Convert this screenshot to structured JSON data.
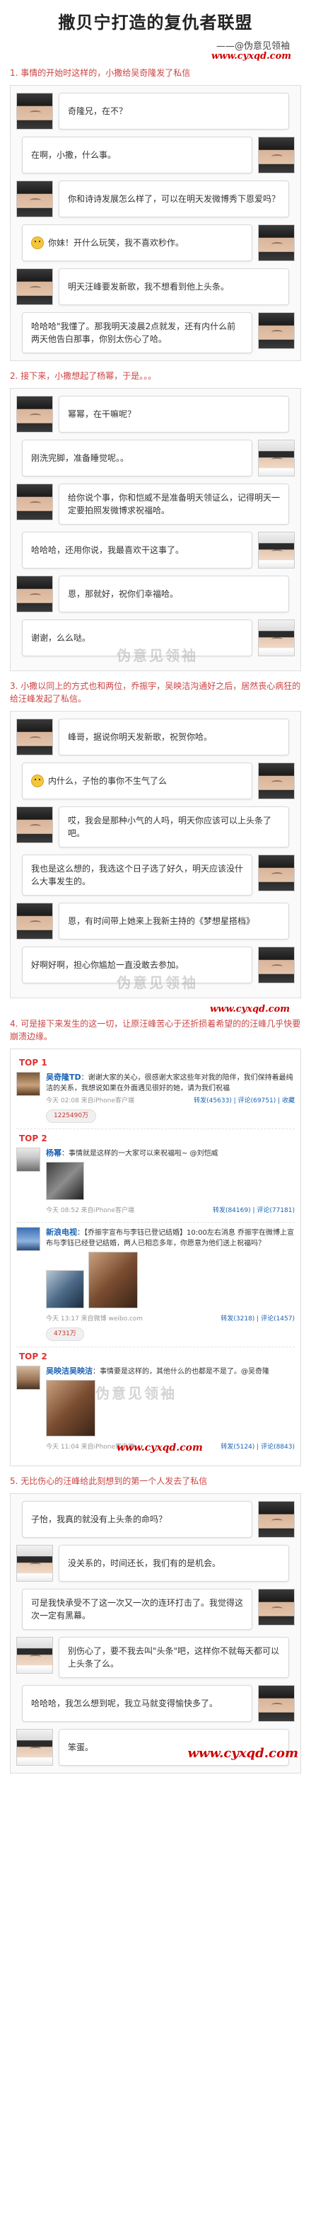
{
  "header": {
    "title": "撒贝宁打造的复仇者联盟",
    "subtitle": "——@伪意见领袖",
    "site": "www.cyxqd.com"
  },
  "sections": [
    {
      "title": "1. 事情的开始时这样的，小撒给吴奇隆发了私信",
      "messages": [
        {
          "side": "left",
          "avatar": "sa",
          "text": "奇隆兄，在不？"
        },
        {
          "side": "right",
          "avatar": "wu",
          "text": "在啊，小撒，什么事。"
        },
        {
          "side": "left",
          "avatar": "sa",
          "text": "你和诗诗发展怎么样了，可以在明天发微博秀下恩爱吗？"
        },
        {
          "side": "right",
          "avatar": "wu",
          "emoji": true,
          "text": "你妹！开什么玩笑，我不喜欢秒作。"
        },
        {
          "side": "left",
          "avatar": "sa",
          "text": "明天汪峰要发新歌，我不想看到他上头条。"
        },
        {
          "side": "right",
          "avatar": "wu",
          "text": "哈哈哈\"我懂了。那我明天凌晨2点就发，还有内什么前两天他告白那事，你别太伤心了哈。"
        }
      ]
    },
    {
      "title": "2. 接下来，小撒想起了杨幂，于是。。。",
      "messages": [
        {
          "side": "left",
          "avatar": "sa",
          "text": "幂幂，在干嘛呢？"
        },
        {
          "side": "right",
          "avatar": "mi",
          "text": "刚洗完脚，准备睡觉呢。。"
        },
        {
          "side": "left",
          "avatar": "sa",
          "text": "给你说个事，你和恺威不是准备明天领证么，记得明天一定要拍照发微博求祝福哈。"
        },
        {
          "side": "right",
          "avatar": "mi",
          "text": "哈哈哈，还用你说，我最喜欢干这事了。"
        },
        {
          "side": "left",
          "avatar": "sa",
          "text": "恩，那就好，祝你们幸福哈。"
        },
        {
          "side": "right",
          "avatar": "mi",
          "text": "谢谢，么么哒。"
        }
      ],
      "watermark": "伪意见领袖"
    },
    {
      "title": "3. 小撒以同上的方式也和两位，乔振宇，吴映洁沟通好之后，居然丧心病狂的给汪峰发起了私信。",
      "messages": [
        {
          "side": "left",
          "avatar": "sa",
          "text": "峰哥，据说你明天发新歌，祝贺你哈。"
        },
        {
          "side": "right",
          "avatar": "wang",
          "emoji": true,
          "text": "内什么，子怡的事你不生气了么"
        },
        {
          "side": "left",
          "avatar": "sa",
          "text": "哎，我会是那种小气的人吗，明天你应该可以上头条了吧。"
        },
        {
          "side": "right",
          "avatar": "wang",
          "text": "我也是这么想的，我选这个日子选了好久，明天应该没什么大事发生的。"
        },
        {
          "side": "left",
          "avatar": "sa",
          "text": "恩，有时间带上她来上我新主持的《梦想星搭档》"
        },
        {
          "side": "right",
          "avatar": "wang",
          "text": "好啊好啊，担心你尴尬一直没敢去参加。"
        }
      ],
      "watermark": "伪意见领袖",
      "site": "www.cyxqd.com"
    }
  ],
  "section4": {
    "title": "4. 可是接下来发生的这一切，让原汪峰苦心于还折损着希望的的汪峰几乎快要崩溃边缘。",
    "tops": [
      {
        "label": "TOP 1",
        "name": "吴奇隆TD",
        "text": "谢谢大家的关心，很感谢大家这些年对我的陪伴，我们保持着最纯洁的关系，我想说如果在外面遇见很好的她，请为我们祝福",
        "meta": "今天 02:08 来自iPhone客户端",
        "actions": "转发(45633) | 评论(69751) | 收藏",
        "pill": "1225490万",
        "thumbs": 0
      },
      {
        "label": "TOP 2",
        "name": "杨幂",
        "text": "事情就是这样的一大家可以来祝福啦~ @刘恺威",
        "meta": "今天 08:52 来自iPhone客户端",
        "actions": "转发(84169) | 评论(77181)",
        "pill": "",
        "thumbs": 1
      },
      {
        "label": "",
        "name": "新浪电视",
        "text": "【乔振宇宣布与李钰已登记结婚】10:00左右消息 乔振宇在微博上宣布与李钰已经登记结婚，两人已相恋多年，你愿意为他们送上祝福吗？",
        "meta": "今天 13:17 来自微博 weibo.com",
        "actions": "转发(3218) | 评论(1457)",
        "pill": "4731万",
        "thumbs": 2
      },
      {
        "label": "TOP 2",
        "name": "吴映洁吴映洁",
        "text": "事情要是这样的，其他什么的也都是不是了。@吴奇隆",
        "meta": "今天 11:04 来自iPhone客户端",
        "actions": "转发(5124) | 评论(8843)",
        "pill": "",
        "thumbs": 1
      }
    ],
    "watermark": "伪意见领袖",
    "site": "www.cyxqd.com"
  },
  "section5": {
    "title": "5. 无比伤心的汪峰给此刻想到的第一个人发去了私信",
    "messages": [
      {
        "side": "right",
        "avatar": "wang",
        "text": "子怡，我真的就没有上头条的命吗？"
      },
      {
        "side": "left",
        "avatar": "zi",
        "text": "没关系的，时间还长，我们有的是机会。"
      },
      {
        "side": "right",
        "avatar": "wang",
        "text": "可是我快承受不了这一次又一次的连环打击了。我觉得这次一定有黑幕。"
      },
      {
        "side": "left",
        "avatar": "zi",
        "text": "别伤心了，要不我去叫\"头条\"吧，这样你不就每天都可以上头条了么。"
      },
      {
        "side": "right",
        "avatar": "wang",
        "text": "哈哈哈，我怎么想到呢，我立马就变得愉快多了。"
      },
      {
        "side": "left",
        "avatar": "zi",
        "text": "笨蛋。"
      }
    ],
    "site": "www.cyxqd.com"
  }
}
